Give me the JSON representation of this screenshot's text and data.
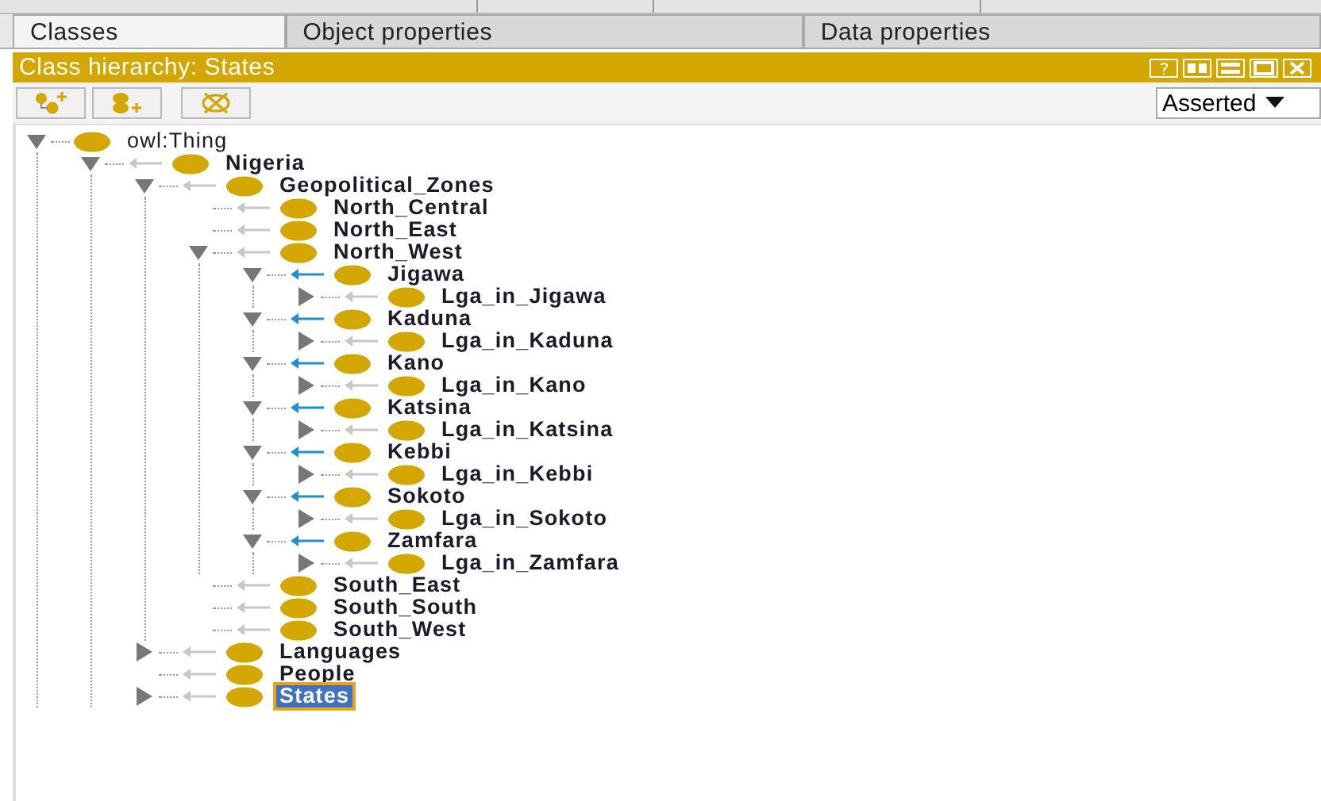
{
  "tabs": [
    {
      "label": "Classes",
      "selected": true
    },
    {
      "label": "Object properties",
      "selected": false
    },
    {
      "label": "Data properties",
      "selected": false
    }
  ],
  "panel": {
    "title": "Class hierarchy: States",
    "view_mode": "Asserted"
  },
  "tree": [
    {
      "label": "owl:Thing",
      "bold": false,
      "selected": false,
      "expanded": true,
      "children": [
        {
          "label": "Nigeria",
          "bold": true,
          "selected": false,
          "highlighted_arrow": false,
          "expanded": true,
          "children": [
            {
              "label": "Geopolitical_Zones",
              "bold": true,
              "selected": false,
              "highlighted_arrow": false,
              "expanded": true,
              "children": [
                {
                  "label": "North_Central",
                  "bold": true,
                  "selected": false,
                  "highlighted_arrow": false
                },
                {
                  "label": "North_East",
                  "bold": true,
                  "selected": false,
                  "highlighted_arrow": false
                },
                {
                  "label": "North_West",
                  "bold": true,
                  "selected": false,
                  "highlighted_arrow": false,
                  "expanded": true,
                  "children": [
                    {
                      "label": "Jigawa",
                      "bold": true,
                      "selected": false,
                      "highlighted_arrow": true,
                      "expanded": true,
                      "children": [
                        {
                          "label": "Lga_in_Jigawa",
                          "bold": true,
                          "selected": false,
                          "highlighted_arrow": false,
                          "expanded": false
                        }
                      ]
                    },
                    {
                      "label": "Kaduna",
                      "bold": true,
                      "selected": false,
                      "highlighted_arrow": true,
                      "expanded": true,
                      "children": [
                        {
                          "label": "Lga_in_Kaduna",
                          "bold": true,
                          "selected": false,
                          "highlighted_arrow": false,
                          "expanded": false
                        }
                      ]
                    },
                    {
                      "label": "Kano",
                      "bold": true,
                      "selected": false,
                      "highlighted_arrow": true,
                      "expanded": true,
                      "children": [
                        {
                          "label": "Lga_in_Kano",
                          "bold": true,
                          "selected": false,
                          "highlighted_arrow": false,
                          "expanded": false
                        }
                      ]
                    },
                    {
                      "label": "Katsina",
                      "bold": true,
                      "selected": false,
                      "highlighted_arrow": true,
                      "expanded": true,
                      "children": [
                        {
                          "label": "Lga_in_Katsina",
                          "bold": true,
                          "selected": false,
                          "highlighted_arrow": false,
                          "expanded": false
                        }
                      ]
                    },
                    {
                      "label": "Kebbi",
                      "bold": true,
                      "selected": false,
                      "highlighted_arrow": true,
                      "expanded": true,
                      "children": [
                        {
                          "label": "Lga_in_Kebbi",
                          "bold": true,
                          "selected": false,
                          "highlighted_arrow": false,
                          "expanded": false
                        }
                      ]
                    },
                    {
                      "label": "Sokoto",
                      "bold": true,
                      "selected": false,
                      "highlighted_arrow": true,
                      "expanded": true,
                      "children": [
                        {
                          "label": "Lga_in_Sokoto",
                          "bold": true,
                          "selected": false,
                          "highlighted_arrow": false,
                          "expanded": false
                        }
                      ]
                    },
                    {
                      "label": "Zamfara",
                      "bold": true,
                      "selected": false,
                      "highlighted_arrow": true,
                      "expanded": true,
                      "children": [
                        {
                          "label": "Lga_in_Zamfara",
                          "bold": true,
                          "selected": false,
                          "highlighted_arrow": false,
                          "expanded": false
                        }
                      ]
                    }
                  ]
                },
                {
                  "label": "South_East",
                  "bold": true,
                  "selected": false,
                  "highlighted_arrow": false
                },
                {
                  "label": "South_South",
                  "bold": true,
                  "selected": false,
                  "highlighted_arrow": false
                },
                {
                  "label": "South_West",
                  "bold": true,
                  "selected": false,
                  "highlighted_arrow": false
                }
              ]
            },
            {
              "label": "Languages",
              "bold": true,
              "selected": false,
              "highlighted_arrow": false,
              "expanded": false
            },
            {
              "label": "People",
              "bold": true,
              "selected": false,
              "highlighted_arrow": false
            },
            {
              "label": "States",
              "bold": true,
              "selected": true,
              "highlighted_arrow": false,
              "expanded": false
            }
          ]
        }
      ]
    }
  ]
}
